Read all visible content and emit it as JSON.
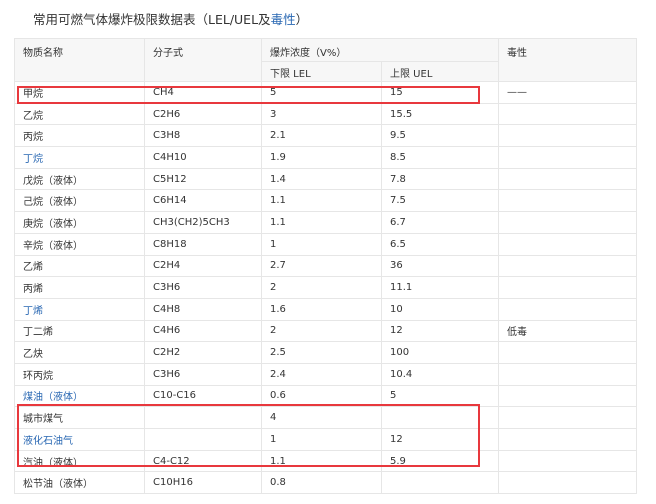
{
  "title": {
    "text": "常用可燃气体爆炸极限数据表（LEL/UEL及",
    "link": "毒性",
    "suffix": "）"
  },
  "header": {
    "name": "物质名称",
    "formula": "分子式",
    "concentration": "爆炸浓度（V%）",
    "lower": "下限 LEL",
    "upper": "上限 UEL",
    "toxicity": "毒性"
  },
  "rows": [
    {
      "name": "甲烷",
      "link": false,
      "formula": "CH4",
      "lel": "5",
      "uel": "15",
      "tox": "——"
    },
    {
      "name": "乙烷",
      "link": false,
      "formula": "C2H6",
      "lel": "3",
      "uel": "15.5",
      "tox": ""
    },
    {
      "name": "丙烷",
      "link": false,
      "formula": "C3H8",
      "lel": "2.1",
      "uel": "9.5",
      "tox": ""
    },
    {
      "name": "丁烷",
      "link": true,
      "formula": "C4H10",
      "lel": "1.9",
      "uel": "8.5",
      "tox": ""
    },
    {
      "name": "戊烷（液体）",
      "link": false,
      "formula": "C5H12",
      "lel": "1.4",
      "uel": "7.8",
      "tox": ""
    },
    {
      "name": "己烷（液体）",
      "link": false,
      "formula": "C6H14",
      "lel": "1.1",
      "uel": "7.5",
      "tox": ""
    },
    {
      "name": "庚烷（液体）",
      "link": false,
      "formula": "CH3(CH2)5CH3",
      "lel": "1.1",
      "uel": "6.7",
      "tox": ""
    },
    {
      "name": "辛烷（液体）",
      "link": false,
      "formula": "C8H18",
      "lel": "1",
      "uel": "6.5",
      "tox": ""
    },
    {
      "name": "乙烯",
      "link": false,
      "formula": "C2H4",
      "lel": "2.7",
      "uel": "36",
      "tox": ""
    },
    {
      "name": "丙烯",
      "link": false,
      "formula": "C3H6",
      "lel": "2",
      "uel": "11.1",
      "tox": ""
    },
    {
      "name": "丁烯",
      "link": true,
      "formula": "C4H8",
      "lel": "1.6",
      "uel": "10",
      "tox": ""
    },
    {
      "name": "丁二烯",
      "link": false,
      "formula": "C4H6",
      "lel": "2",
      "uel": "12",
      "tox": "低毒"
    },
    {
      "name": "乙炔",
      "link": false,
      "formula": "C2H2",
      "lel": "2.5",
      "uel": "100",
      "tox": ""
    },
    {
      "name": "环丙烷",
      "link": false,
      "formula": "C3H6",
      "lel": "2.4",
      "uel": "10.4",
      "tox": ""
    },
    {
      "name": "煤油（液体）",
      "link": true,
      "formula": "C10-C16",
      "lel": "0.6",
      "uel": "5",
      "tox": ""
    },
    {
      "name": "城市煤气",
      "link": false,
      "formula": "",
      "lel": "4",
      "uel": "",
      "tox": ""
    },
    {
      "name": "液化石油气",
      "link": true,
      "formula": "",
      "lel": "1",
      "uel": "12",
      "tox": ""
    },
    {
      "name": "汽油（液体）",
      "link": false,
      "formula": "C4-C12",
      "lel": "1.1",
      "uel": "5.9",
      "tox": ""
    },
    {
      "name": "松节油（液体）",
      "link": false,
      "formula": "C10H16",
      "lel": "0.8",
      "uel": "",
      "tox": ""
    }
  ],
  "colors": {
    "link": "#2a68b3",
    "highlight": "#e8383d",
    "border": "#e6e6e6",
    "header_bg": "#f7f7f7"
  }
}
